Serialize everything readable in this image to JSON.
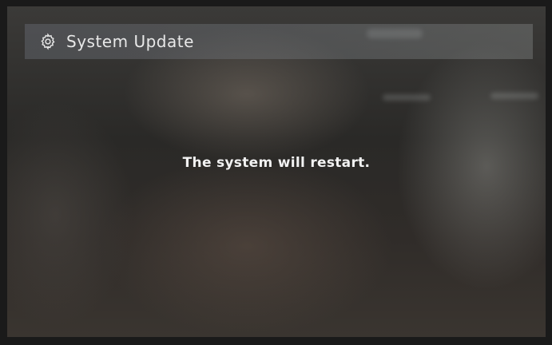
{
  "header": {
    "icon": "gear-icon",
    "title": "System Update"
  },
  "main": {
    "message": "The system will restart."
  }
}
